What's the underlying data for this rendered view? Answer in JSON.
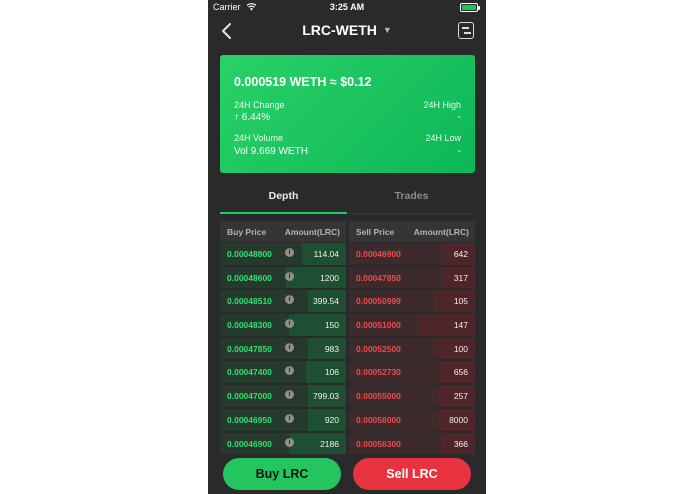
{
  "status_bar": {
    "carrier": "Carrier",
    "time": "3:25 AM"
  },
  "nav": {
    "title": "LRC-WETH"
  },
  "ticker": {
    "price": "0.000519 WETH ≈ $0.12",
    "change_label": "24H Change",
    "change_value": "↑ 6.44%",
    "high_label": "24H High",
    "high_value": "-",
    "volume_label": "24H Volume",
    "volume_value": "Vol 9.669 WETH",
    "low_label": "24H Low",
    "low_value": "-"
  },
  "tabs": [
    {
      "label": "Depth"
    },
    {
      "label": "Trades"
    }
  ],
  "buy_book": {
    "headers": [
      "Buy Price",
      "Amount(LRC)"
    ],
    "rows": [
      {
        "price": "0.00048800",
        "amount": "114.04",
        "fill": 0.35
      },
      {
        "price": "0.00048600",
        "amount": "1200",
        "fill": 0.48
      },
      {
        "price": "0.00048510",
        "amount": "399.54",
        "fill": 0.3
      },
      {
        "price": "0.00048300",
        "amount": "150",
        "fill": 0.45
      },
      {
        "price": "0.00047850",
        "amount": "983",
        "fill": 0.3
      },
      {
        "price": "0.00047400",
        "amount": "106",
        "fill": 0.32
      },
      {
        "price": "0.00047000",
        "amount": "799.03",
        "fill": 0.3
      },
      {
        "price": "0.00046950",
        "amount": "920",
        "fill": 0.3
      },
      {
        "price": "0.00046900",
        "amount": "2186",
        "fill": 0.45
      }
    ]
  },
  "sell_book": {
    "headers": [
      "Sell Price",
      "Amount(LRC)"
    ],
    "rows": [
      {
        "price": "0.00046900",
        "amount": "642",
        "fill": 0.25
      },
      {
        "price": "0.00047850",
        "amount": "317",
        "fill": 0.25
      },
      {
        "price": "0.00050999",
        "amount": "105",
        "fill": 0.32
      },
      {
        "price": "0.00051000",
        "amount": "147",
        "fill": 0.44
      },
      {
        "price": "0.00052500",
        "amount": "100",
        "fill": 0.31
      },
      {
        "price": "0.00052730",
        "amount": "656",
        "fill": 0.28
      },
      {
        "price": "0.00055000",
        "amount": "257",
        "fill": 0.3
      },
      {
        "price": "0.00056000",
        "amount": "8000",
        "fill": 0.3
      },
      {
        "price": "0.00056300",
        "amount": "366",
        "fill": 0.26
      }
    ]
  },
  "actions": {
    "buy_label": "Buy LRC",
    "sell_label": "Sell LRC"
  },
  "colors": {
    "accent_green": "#22c55e",
    "accent_red": "#e8323f",
    "background": "#2a2a2c"
  }
}
